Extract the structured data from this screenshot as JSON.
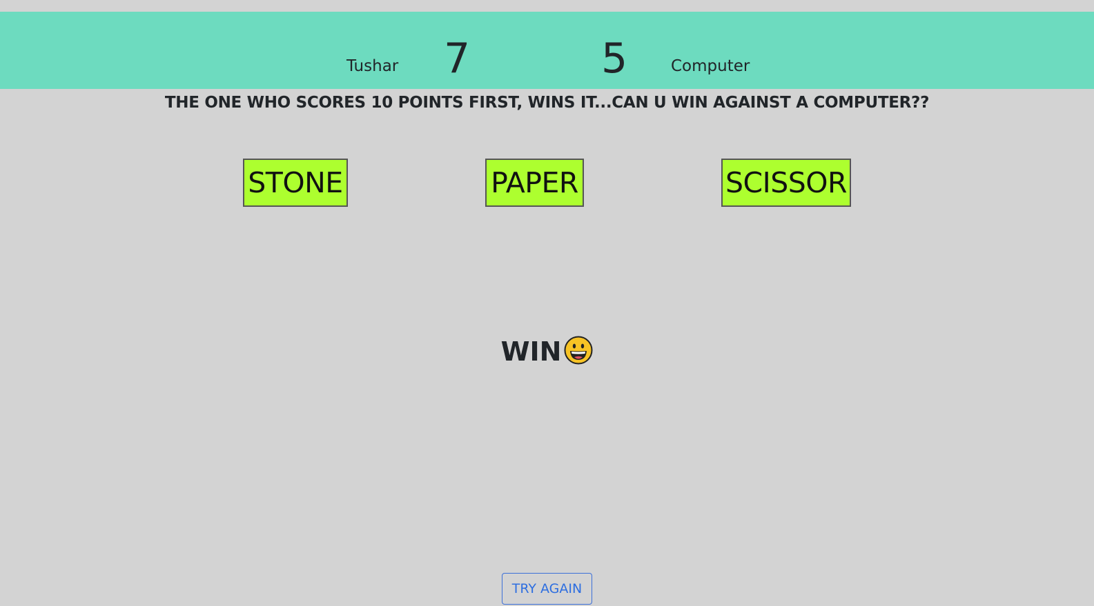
{
  "scoreboard": {
    "user_name": "Tushar",
    "user_score": "7",
    "computer_score": "5",
    "computer_name": "Computer",
    "background_color": "#6ddbbf"
  },
  "rules_text": "THE ONE WHO SCORES 10 POINTS FIRST, WINS IT...CAN U WIN AGAINST A COMPUTER??",
  "choices": {
    "stone": "STONE",
    "paper": "PAPER",
    "scissor": "SCISSOR",
    "button_color": "#adff2f"
  },
  "result": {
    "text": "WIN",
    "emoji_icon": "grinning-face-icon"
  },
  "try_again_label": "TRY AGAIN",
  "page_background": "#d3d3d3"
}
